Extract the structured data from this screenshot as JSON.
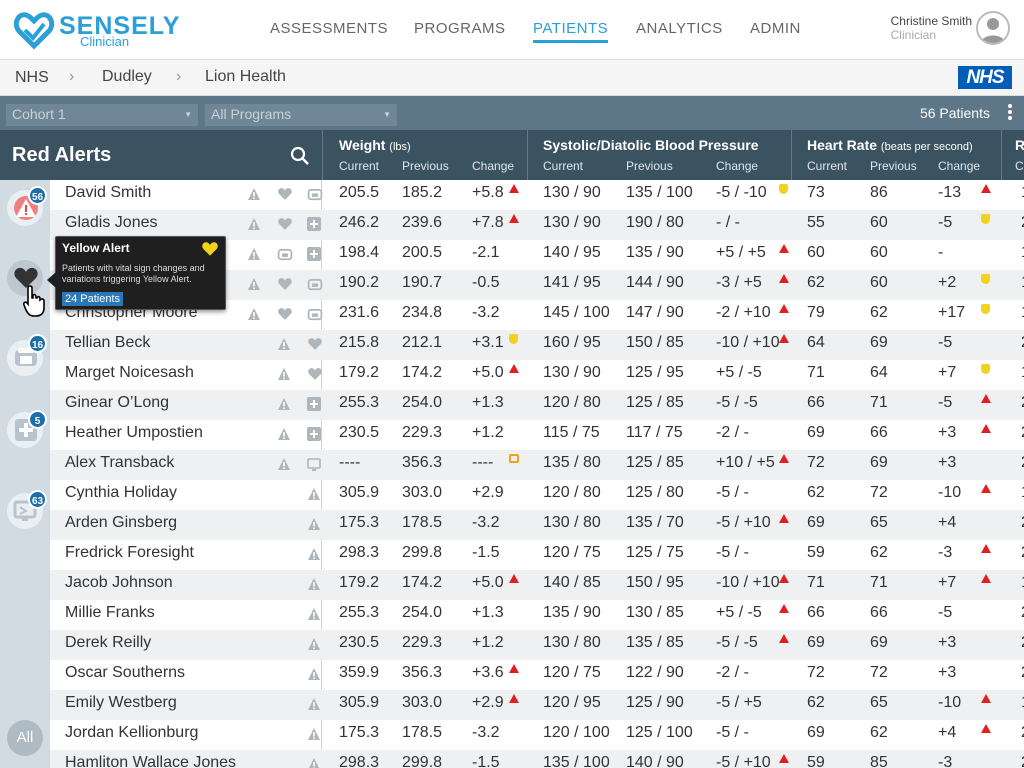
{
  "header": {
    "brand": "SENSELY",
    "brand_sub": "Clinician",
    "nav": [
      "ASSESSMENTS",
      "PROGRAMS",
      "PATIENTS",
      "ANALYTICS",
      "ADMIN"
    ],
    "active_nav": "PATIENTS",
    "user_name": "Christine Smith",
    "user_role": "Clinician",
    "accent": "#2a9fd8"
  },
  "breadcrumb": [
    "NHS",
    "Dudley",
    "Lion Health"
  ],
  "nhs_logo": "NHS",
  "filters": {
    "cohort": "Cohort 1",
    "program": "All Programs",
    "patient_count": "56 Patients"
  },
  "table": {
    "title": "Red Alerts",
    "groups": [
      {
        "label": "Weight",
        "unit": "(lbs)"
      },
      {
        "label": "Systolic/Diatolic Blood Pressure",
        "unit": ""
      },
      {
        "label": "Heart Rate",
        "unit": "(beats per second)"
      },
      {
        "label": "R",
        "unit": ""
      }
    ],
    "subcols": [
      "Current",
      "Previous",
      "Change"
    ],
    "cut_col": "C",
    "rows": [
      {
        "name": "David Smith",
        "w": [
          "205.5",
          "185.2",
          "+5.8"
        ],
        "wf": "red",
        "bp": [
          "130 / 90",
          "135 / 100",
          "-5 / -10"
        ],
        "bf": "yellow",
        "hr": [
          "73",
          "86",
          "-13"
        ],
        "hf": "red",
        "r": "1",
        "icons": [
          "warn",
          "heart",
          "phone"
        ]
      },
      {
        "name": "Gladis Jones",
        "w": [
          "246.2",
          "239.6",
          "+7.8"
        ],
        "wf": "red",
        "bp": [
          "130 / 90",
          "190 / 80",
          "- / -"
        ],
        "bf": "",
        "hr": [
          "55",
          "60",
          "-5"
        ],
        "hf": "yellow",
        "r": "2",
        "icons": [
          "warn",
          "heart",
          "plus"
        ]
      },
      {
        "name": "",
        "w": [
          "198.4",
          "200.5",
          "-2.1"
        ],
        "wf": "",
        "bp": [
          "140 / 95",
          "135 / 90",
          "+5 / +5"
        ],
        "bf": "red",
        "hr": [
          "60",
          "60",
          "-"
        ],
        "hf": "",
        "r": "1",
        "icons": [
          "warn",
          "phone",
          "plus"
        ]
      },
      {
        "name": "",
        "w": [
          "190.2",
          "190.7",
          "-0.5"
        ],
        "wf": "",
        "bp": [
          "141 / 95",
          "144 / 90",
          "-3 / +5"
        ],
        "bf": "red",
        "hr": [
          "62",
          "60",
          "+2"
        ],
        "hf": "yellow",
        "r": "1",
        "icons": [
          "warn",
          "heart",
          "phone"
        ]
      },
      {
        "name": "Christopher Moore",
        "w": [
          "231.6",
          "234.8",
          "-3.2"
        ],
        "wf": "",
        "bp": [
          "145 / 100",
          "147 / 90",
          "-2 / +10"
        ],
        "bf": "red",
        "hr": [
          "79",
          "62",
          "+17"
        ],
        "hf": "yellow",
        "r": "1",
        "icons": [
          "warn",
          "heart",
          "phone"
        ]
      },
      {
        "name": "Tellian Beck",
        "w": [
          "215.8",
          "212.1",
          "+3.1"
        ],
        "wf": "yellow",
        "bp": [
          "160 / 95",
          "150 / 85",
          "-10 / +10"
        ],
        "bf": "red",
        "hr": [
          "64",
          "69",
          "-5"
        ],
        "hf": "",
        "r": "2",
        "icons": [
          "warn",
          "heart"
        ]
      },
      {
        "name": "Marget Noicesash",
        "w": [
          "179.2",
          "174.2",
          "+5.0"
        ],
        "wf": "red",
        "bp": [
          "130 / 90",
          "125 / 95",
          "+5 / -5"
        ],
        "bf": "",
        "hr": [
          "71",
          "64",
          "+7"
        ],
        "hf": "yellow",
        "r": "1",
        "icons": [
          "warn",
          "heart"
        ]
      },
      {
        "name": "Ginear O’Long",
        "w": [
          "255.3",
          "254.0",
          "+1.3"
        ],
        "wf": "",
        "bp": [
          "120 / 80",
          "125 / 85",
          "-5 / -5"
        ],
        "bf": "",
        "hr": [
          "66",
          "71",
          "-5"
        ],
        "hf": "red",
        "r": "2",
        "icons": [
          "warn",
          "plus"
        ]
      },
      {
        "name": "Heather Umpostien",
        "w": [
          "230.5",
          "229.3",
          "+1.2"
        ],
        "wf": "",
        "bp": [
          "115 / 75",
          "117 / 75",
          "-2 / -"
        ],
        "bf": "",
        "hr": [
          "69",
          "66",
          "+3"
        ],
        "hf": "red",
        "r": "2",
        "icons": [
          "warn",
          "plus"
        ]
      },
      {
        "name": "Alex Transback",
        "w": [
          "----",
          "356.3",
          "----"
        ],
        "wf": "tv",
        "bp": [
          "135 / 80",
          "125 / 85",
          "+10 / +5"
        ],
        "bf": "red",
        "hr": [
          "72",
          "69",
          "+3"
        ],
        "hf": "",
        "r": "2",
        "icons": [
          "warn",
          "tv"
        ]
      },
      {
        "name": "Cynthia Holiday",
        "w": [
          "305.9",
          "303.0",
          "+2.9"
        ],
        "wf": "",
        "bp": [
          "120 / 80",
          "125 / 80",
          "-5 / -"
        ],
        "bf": "",
        "hr": [
          "62",
          "72",
          "-10"
        ],
        "hf": "red",
        "r": "1",
        "icons": [
          "warn"
        ]
      },
      {
        "name": "Arden Ginsberg",
        "w": [
          "175.3",
          "178.5",
          "-3.2"
        ],
        "wf": "",
        "bp": [
          "130 / 80",
          "135 / 70",
          "-5 / +10"
        ],
        "bf": "red",
        "hr": [
          "69",
          "65",
          "+4"
        ],
        "hf": "",
        "r": "2",
        "icons": [
          "warn"
        ]
      },
      {
        "name": "Fredrick Foresight",
        "w": [
          "298.3",
          "299.8",
          "-1.5"
        ],
        "wf": "",
        "bp": [
          "120 / 75",
          "125 / 75",
          "-5 / -"
        ],
        "bf": "",
        "hr": [
          "59",
          "62",
          "-3"
        ],
        "hf": "red",
        "r": "2",
        "icons": [
          "warn"
        ]
      },
      {
        "name": "Jacob Johnson",
        "w": [
          "179.2",
          "174.2",
          "+5.0"
        ],
        "wf": "red",
        "bp": [
          "140 / 85",
          "150 / 95",
          "-10 / +10"
        ],
        "bf": "red",
        "hr": [
          "71",
          "71",
          "+7"
        ],
        "hf": "red",
        "r": "1",
        "icons": [
          "warn"
        ]
      },
      {
        "name": "Millie Franks",
        "w": [
          "255.3",
          "254.0",
          "+1.3"
        ],
        "wf": "",
        "bp": [
          "135 / 90",
          "130 / 85",
          "+5 / -5"
        ],
        "bf": "red",
        "hr": [
          "66",
          "66",
          "-5"
        ],
        "hf": "",
        "r": "2",
        "icons": [
          "warn"
        ]
      },
      {
        "name": "Derek Reilly",
        "w": [
          "230.5",
          "229.3",
          "+1.2"
        ],
        "wf": "",
        "bp": [
          "130 / 80",
          "135 / 85",
          "-5 / -5"
        ],
        "bf": "red",
        "hr": [
          "69",
          "69",
          "+3"
        ],
        "hf": "",
        "r": "2",
        "icons": [
          "warn"
        ]
      },
      {
        "name": "Oscar Southerns",
        "w": [
          "359.9",
          "356.3",
          "+3.6"
        ],
        "wf": "red",
        "bp": [
          "120 / 75",
          "122 / 90",
          "-2 / -"
        ],
        "bf": "",
        "hr": [
          "72",
          "72",
          "+3"
        ],
        "hf": "",
        "r": "2",
        "icons": [
          "warn"
        ]
      },
      {
        "name": "Emily Westberg",
        "w": [
          "305.9",
          "303.0",
          "+2.9"
        ],
        "wf": "red",
        "bp": [
          "120 / 95",
          "125 / 90",
          "-5 / +5"
        ],
        "bf": "",
        "hr": [
          "62",
          "65",
          "-10"
        ],
        "hf": "red",
        "r": "1",
        "icons": [
          "warn"
        ]
      },
      {
        "name": "Jordan Kellionburg",
        "w": [
          "175.3",
          "178.5",
          "-3.2"
        ],
        "wf": "",
        "bp": [
          "120 / 100",
          "125 / 100",
          "-5 / -"
        ],
        "bf": "",
        "hr": [
          "69",
          "62",
          "+4"
        ],
        "hf": "red",
        "r": "2",
        "icons": [
          "warn"
        ]
      },
      {
        "name": "Hamliton Wallace Jones",
        "w": [
          "298.3",
          "299.8",
          "-1.5"
        ],
        "wf": "",
        "bp": [
          "135 / 100",
          "140 / 90",
          "-5 / +10"
        ],
        "bf": "red",
        "hr": [
          "59",
          "85",
          "-3"
        ],
        "hf": "",
        "r": "2",
        "icons": [
          "warn"
        ]
      }
    ]
  },
  "rail": [
    {
      "icon": "red-alert-icon",
      "badge": "56"
    },
    {
      "icon": "heart-icon",
      "badge": ""
    },
    {
      "icon": "phone-icon",
      "badge": "16"
    },
    {
      "icon": "plus-icon",
      "badge": "5"
    },
    {
      "icon": "tv-icon",
      "badge": "63"
    }
  ],
  "rail_all": "All",
  "tooltip": {
    "title": "Yellow Alert",
    "desc": "Patients with vital sign changes and variations triggering Yellow Alert.",
    "count": "24 Patients"
  }
}
